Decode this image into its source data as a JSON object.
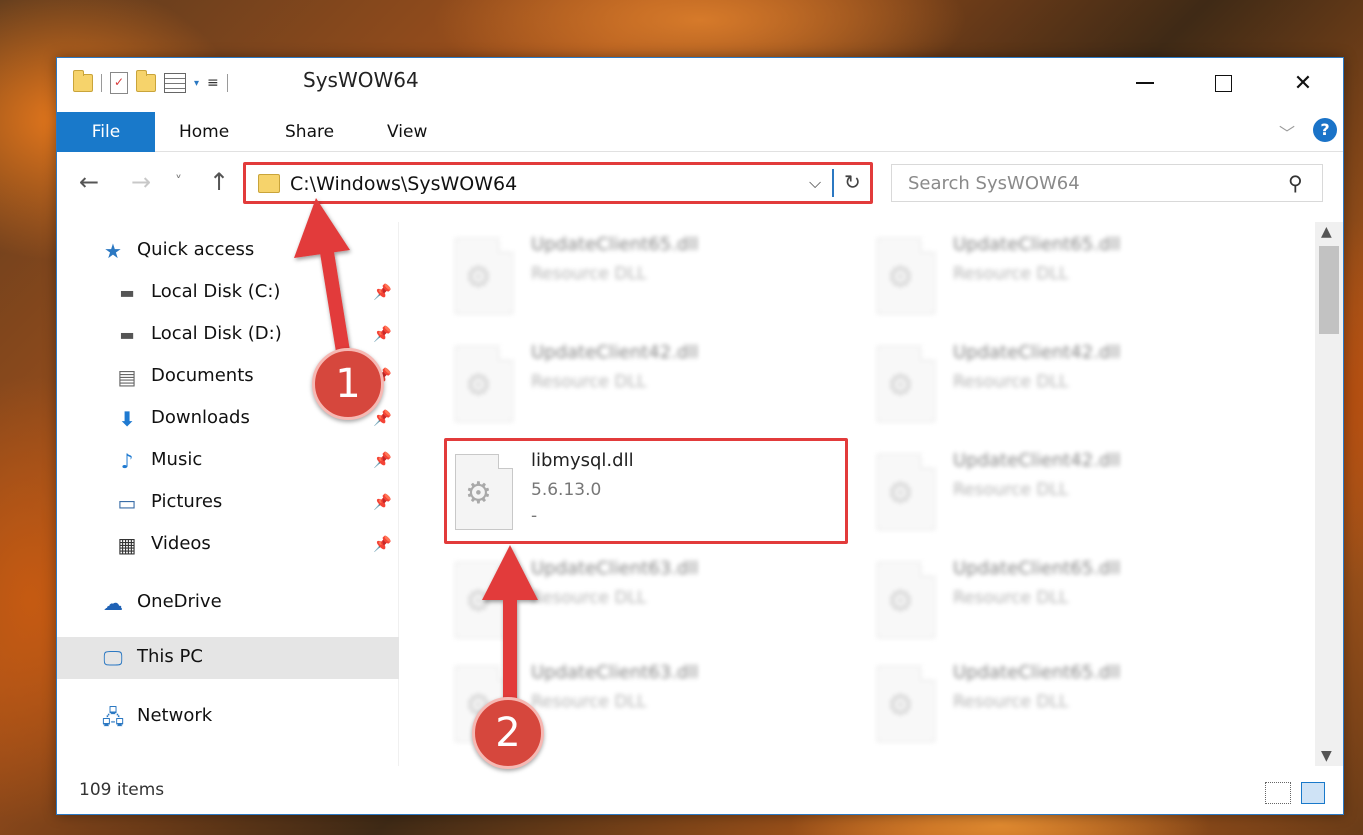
{
  "window": {
    "title": "SysWOW64"
  },
  "ribbon": {
    "tabs": [
      "File",
      "Home",
      "Share",
      "View"
    ]
  },
  "address": {
    "path": "C:\\Windows\\SysWOW64"
  },
  "search": {
    "placeholder": "Search SysWOW64"
  },
  "sidebar": {
    "items": [
      {
        "label": "Quick access",
        "icon": "star-icon",
        "pinned": false
      },
      {
        "label": "Local Disk (C:)",
        "icon": "drive-c-icon",
        "pinned": true
      },
      {
        "label": "Local Disk (D:)",
        "icon": "drive-d-icon",
        "pinned": true
      },
      {
        "label": "Documents",
        "icon": "documents-icon",
        "pinned": true
      },
      {
        "label": "Downloads",
        "icon": "download-icon",
        "pinned": true
      },
      {
        "label": "Music",
        "icon": "music-icon",
        "pinned": true
      },
      {
        "label": "Pictures",
        "icon": "pictures-icon",
        "pinned": true
      },
      {
        "label": "Videos",
        "icon": "videos-icon",
        "pinned": true
      },
      {
        "label": "OneDrive",
        "icon": "onedrive-icon",
        "pinned": false
      },
      {
        "label": "This PC",
        "icon": "this-pc-icon",
        "pinned": false,
        "selected": true
      },
      {
        "label": "Network",
        "icon": "network-icon",
        "pinned": false
      }
    ]
  },
  "files": [
    {
      "name": "UpdateClient65.dll",
      "sub": "Resource DLL",
      "blurred": true
    },
    {
      "name": "UpdateClient65.dll",
      "sub": "Resource DLL",
      "blurred": true
    },
    {
      "name": "UpdateClient42.dll",
      "sub": "Resource DLL",
      "blurred": true
    },
    {
      "name": "UpdateClient42.dll",
      "sub": "Resource DLL",
      "blurred": true
    },
    {
      "name": "libmysql.dll",
      "sub": "5.6.13.0",
      "sub2": "-",
      "blurred": false,
      "highlighted": true
    },
    {
      "name": "UpdateClient42.dll",
      "sub": "Resource DLL",
      "blurred": true
    },
    {
      "name": "UpdateClient63.dll",
      "sub": "Resource DLL",
      "blurred": true
    },
    {
      "name": "UpdateClient65.dll",
      "sub": "Resource DLL",
      "blurred": true
    },
    {
      "name": "UpdateClient63.dll",
      "sub": "Resource DLL",
      "blurred": true
    },
    {
      "name": "UpdateClient65.dll",
      "sub": "Resource DLL",
      "blurred": true
    }
  ],
  "status": {
    "item_count": "109 items"
  },
  "annotations": {
    "badge1": "1",
    "badge2": "2",
    "color": "#e23b3b"
  },
  "icons": {
    "help": "?",
    "pin": "pin-icon",
    "refresh": "refresh-icon",
    "search": "search-icon"
  }
}
